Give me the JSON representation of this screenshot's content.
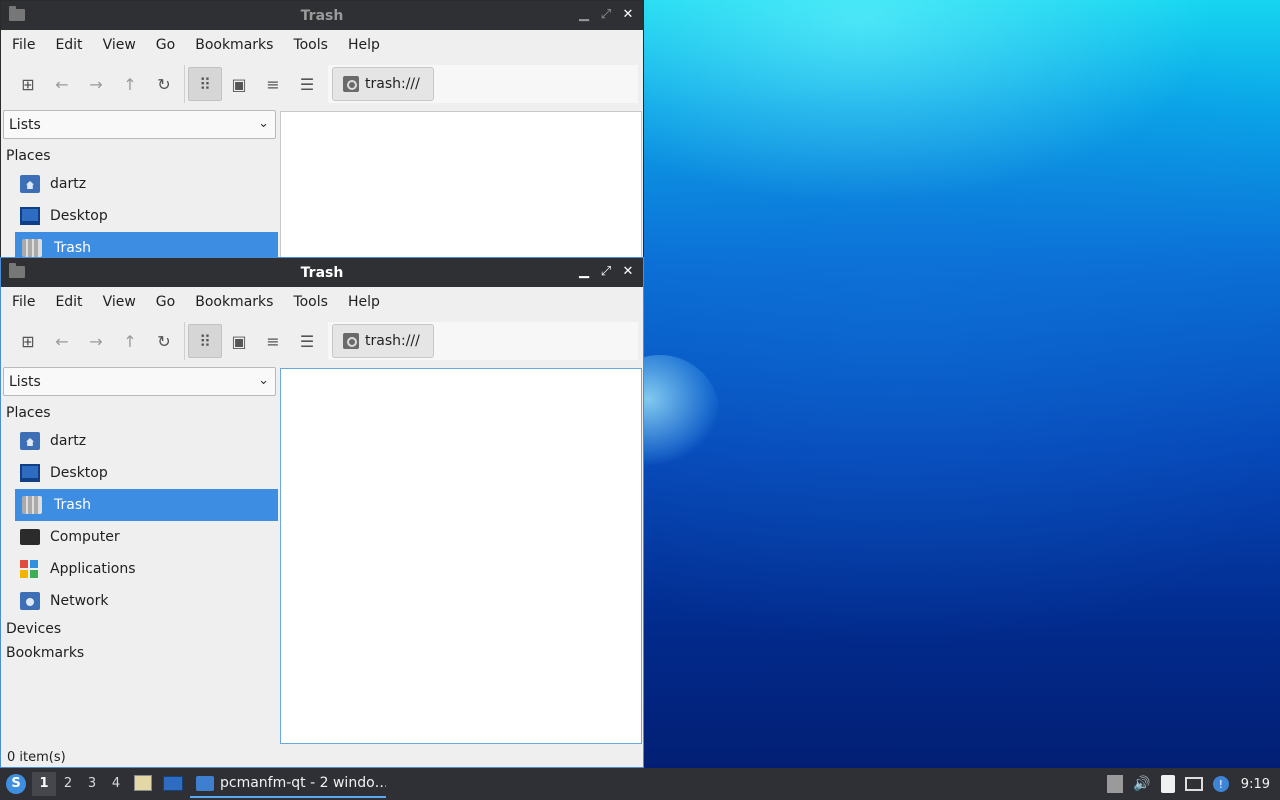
{
  "app_title": "Trash",
  "menu": [
    "File",
    "Edit",
    "View",
    "Go",
    "Bookmarks",
    "Tools",
    "Help"
  ],
  "toolbar": {
    "icons": [
      "new-tab-icon",
      "back-arrow-icon",
      "forward-arrow-icon",
      "up-arrow-icon",
      "reload-icon",
      "icon-view-icon",
      "thumbnail-view-icon",
      "compact-view-icon",
      "detailed-list-view-icon"
    ],
    "path": "trash:///"
  },
  "sidebar": {
    "mode": "Lists",
    "places_header": "Places",
    "places": [
      {
        "label": "dartz",
        "icon": "home-folder-icon"
      },
      {
        "label": "Desktop",
        "icon": "desktop-icon"
      },
      {
        "label": "Trash",
        "icon": "trash-icon",
        "selected": true
      },
      {
        "label": "Computer",
        "icon": "computer-icon"
      },
      {
        "label": "Applications",
        "icon": "applications-icon"
      },
      {
        "label": "Network",
        "icon": "network-icon"
      }
    ],
    "devices_header": "Devices",
    "bookmarks_header": "Bookmarks"
  },
  "status": "0 item(s)",
  "taskbar": {
    "workspaces": [
      "1",
      "2",
      "3",
      "4"
    ],
    "active_workspace": "1",
    "task_label": "pcmanfm-qt - 2 windo…",
    "clock": "9:19"
  },
  "colors": {
    "selection": "#3d8ee3",
    "titlebar": "#2f3034",
    "taskbar": "#2f3035",
    "accent": "#5ca8f0"
  }
}
